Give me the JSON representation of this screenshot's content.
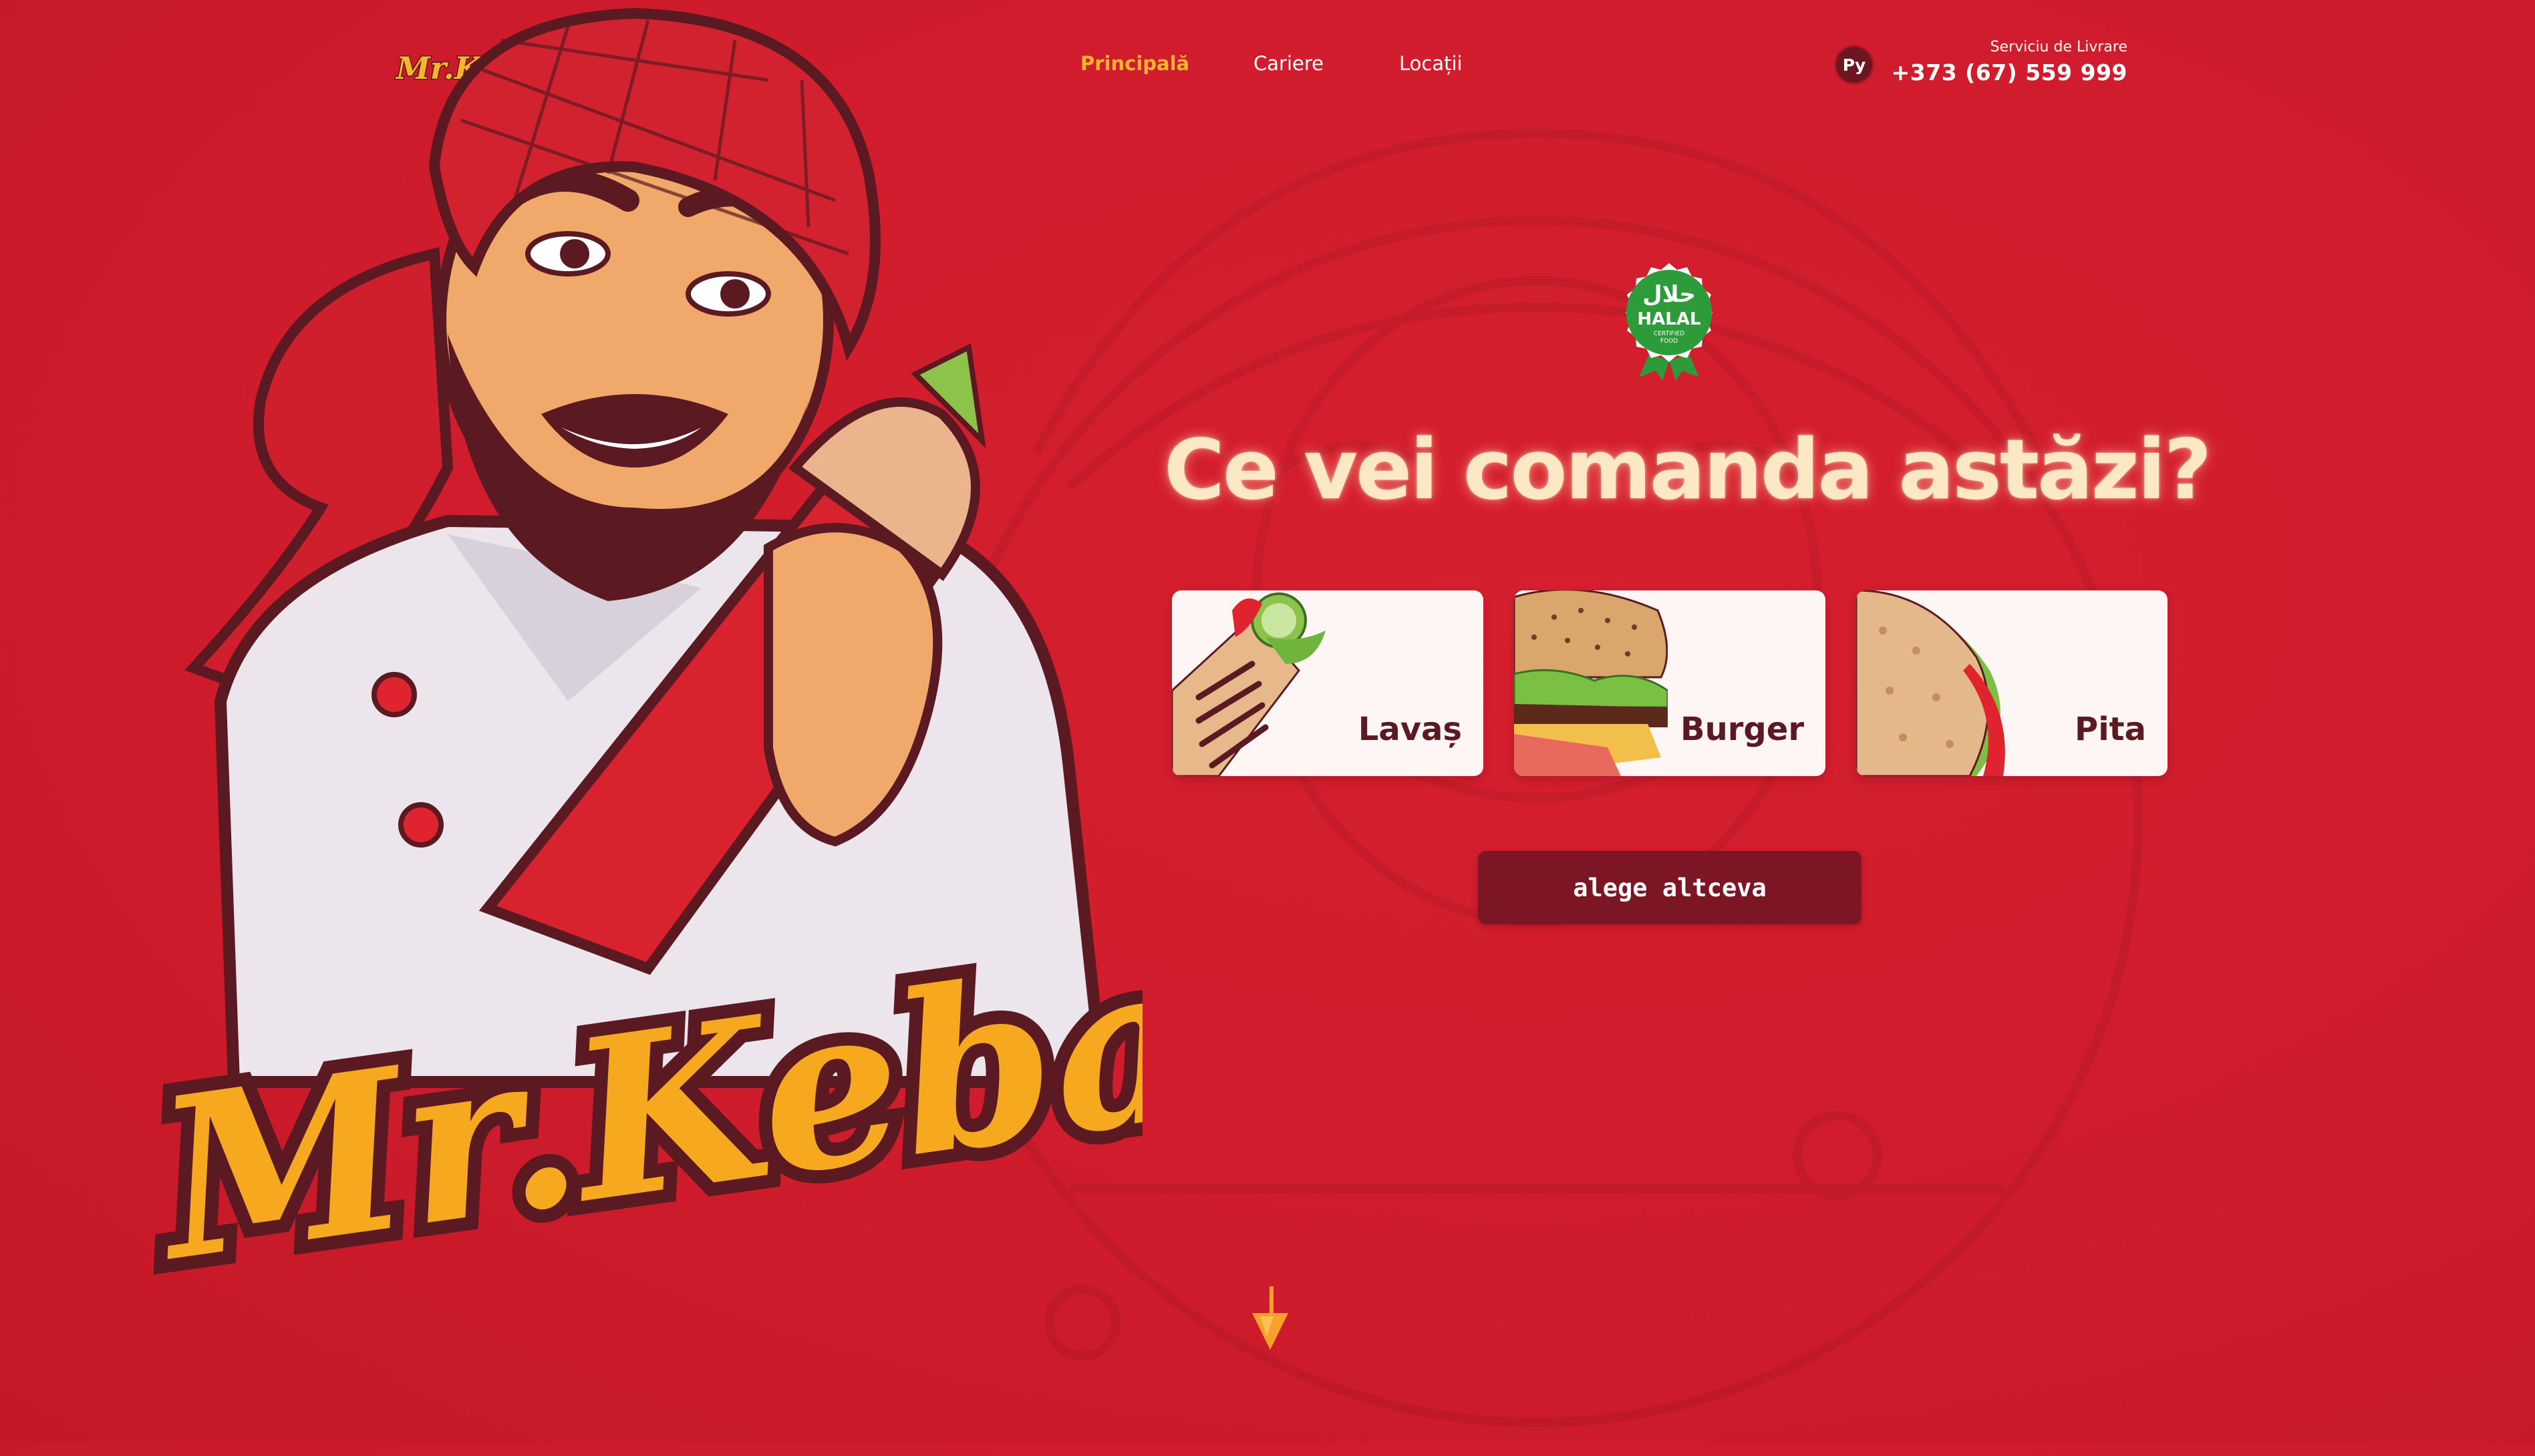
{
  "brand": {
    "logo_text": "Mr.Kebab",
    "mascot_text": "Mr.Kebab",
    "accent": "#f7b52a",
    "background": "#d11e2e",
    "button_color": "#7d1624",
    "text_dark": "#5b1a22"
  },
  "nav": {
    "items": [
      {
        "label": "Principală",
        "active": true
      },
      {
        "label": "Cariere",
        "active": false
      },
      {
        "label": "Locații",
        "active": false
      }
    ]
  },
  "language": {
    "current": "Ру"
  },
  "delivery": {
    "label": "Serviciu de Livrare",
    "phone": "+373 (67) 559 999"
  },
  "badge": {
    "arabic": "حلال",
    "title": "HALAL",
    "subtitle_line1": "CERTIFIED",
    "subtitle_line2": "FOOD"
  },
  "hero": {
    "headline": "Ce vei comanda astăzi?",
    "categories": [
      {
        "label": "Lavaș",
        "icon": "lavash-icon"
      },
      {
        "label": "Burger",
        "icon": "burger-icon"
      },
      {
        "label": "Pita",
        "icon": "pita-icon"
      }
    ],
    "alt_button": "alege altceva",
    "scroll_icon": "arrow-down-icon"
  }
}
